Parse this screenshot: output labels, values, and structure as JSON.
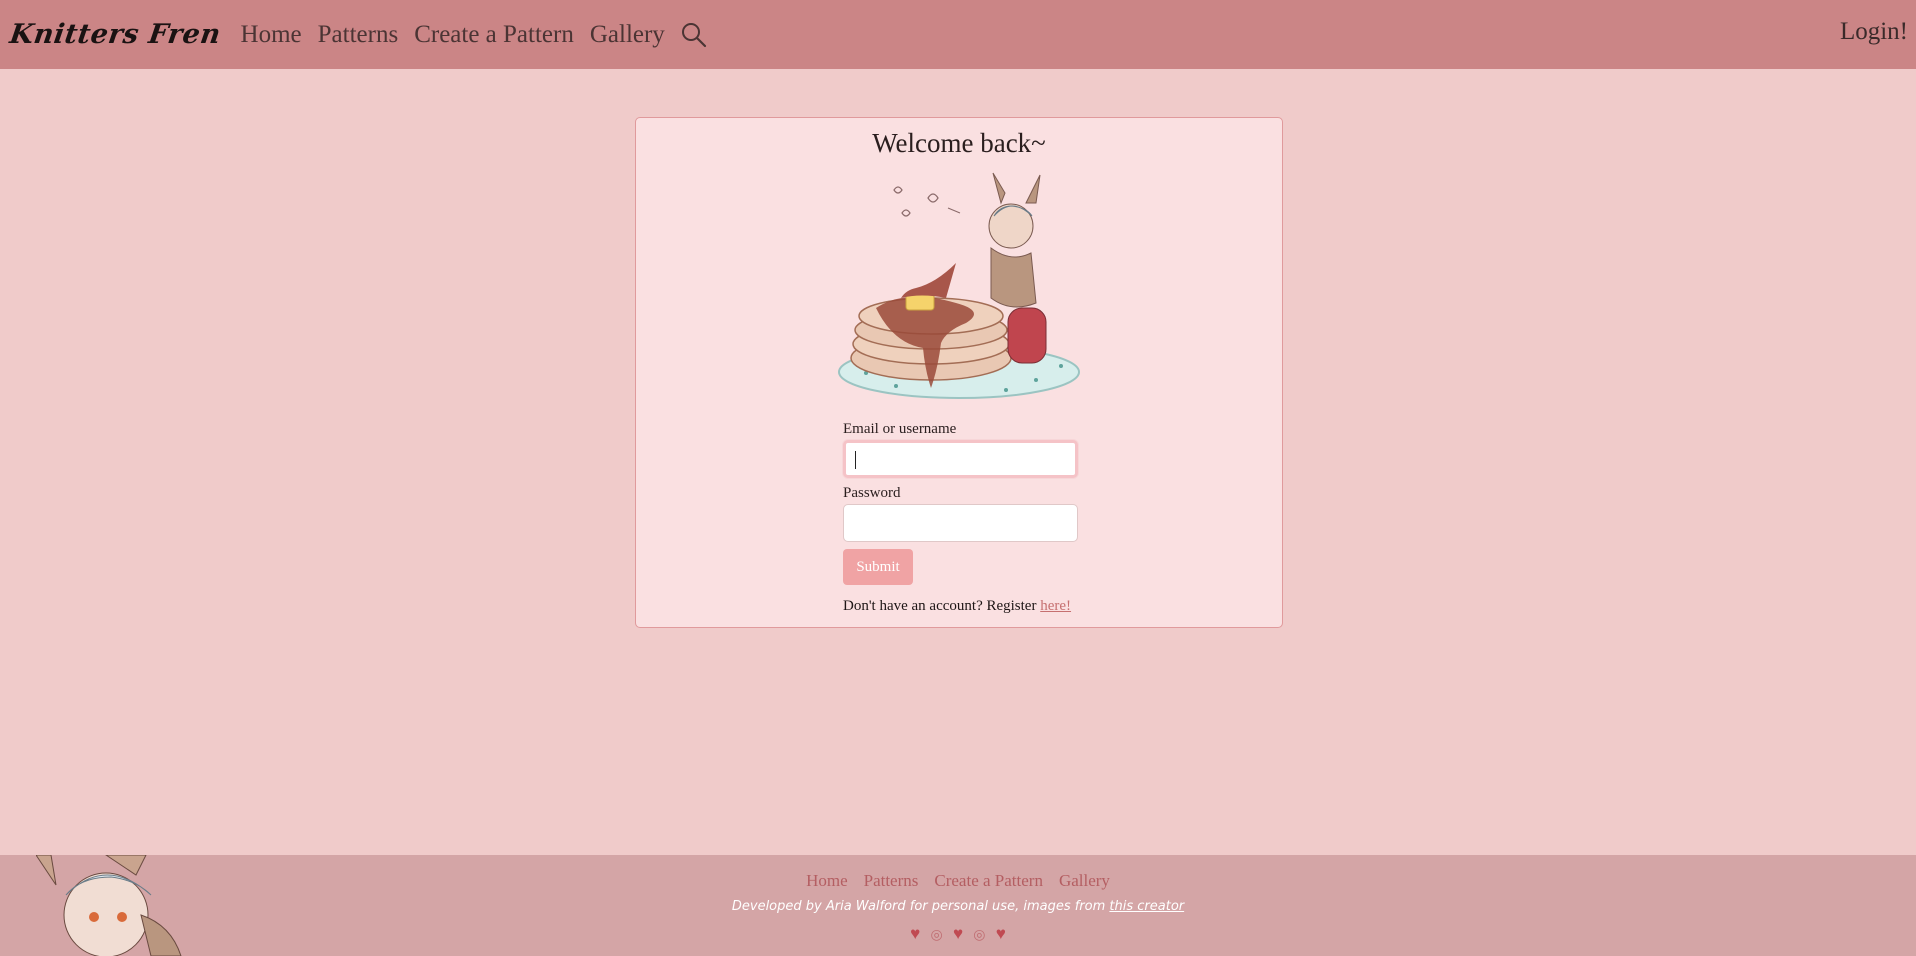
{
  "nav": {
    "brand": "Knitters Fren",
    "links": [
      "Home",
      "Patterns",
      "Create a Pattern",
      "Gallery"
    ],
    "search_icon": "search-icon",
    "login": "Login!"
  },
  "login_card": {
    "title": "Welcome back~",
    "illustration": "bunny-girl-with-pancakes-illustration",
    "email_label": "Email or username",
    "email_value": "",
    "password_label": "Password",
    "password_value": "",
    "submit": "Submit",
    "register_text": "Don't have an account? Register ",
    "register_link": "here!"
  },
  "footer": {
    "links": [
      "Home",
      "Patterns",
      "Create a Pattern",
      "Gallery"
    ],
    "credit_text": "Developed by Aria Walford for personal use, images from ",
    "credit_link": "this creator",
    "icons": [
      "heart-icon",
      "yarn-icon",
      "heart-icon",
      "yarn-icon",
      "heart-icon"
    ]
  },
  "colors": {
    "navbar": "#cb8586",
    "background": "#f0cbca",
    "card": "#fae0e1",
    "submit": "#f0a3a4",
    "footer": "#d4a5a6"
  }
}
